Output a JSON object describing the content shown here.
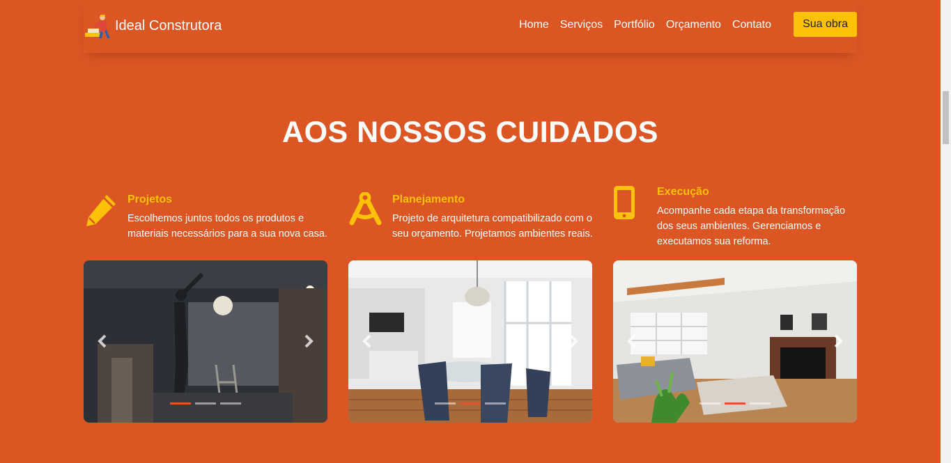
{
  "header": {
    "brand": "Ideal Construtora",
    "nav": [
      "Home",
      "Serviços",
      "Portfólio",
      "Orçamento",
      "Contato"
    ],
    "cta": "Sua obra"
  },
  "section": {
    "title": "AOS NOSSOS CUIDADOS",
    "features": [
      {
        "icon": "pencil-icon",
        "title": "Projetos",
        "description": "Escolhemos juntos todos os produtos e materiais necessários para a sua nova casa."
      },
      {
        "icon": "compass-icon",
        "title": "Planejamento",
        "description": "Projeto de arquitetura compatibilizado com o seu orçamento. Projetamos ambientes reais."
      },
      {
        "icon": "mobile-icon",
        "title": "Execução",
        "description": "Acompanhe cada etapa da transformação dos seus ambientes. Gerenciamos e executamos sua reforma."
      }
    ],
    "carousels": [
      {
        "active_slide": 1,
        "slides": 3
      },
      {
        "active_slide": 2,
        "slides": 3
      },
      {
        "active_slide": 2,
        "slides": 3
      }
    ]
  },
  "colors": {
    "background": "#dc5624",
    "accent": "#fdc107",
    "indicator_active": "#e4532a"
  }
}
